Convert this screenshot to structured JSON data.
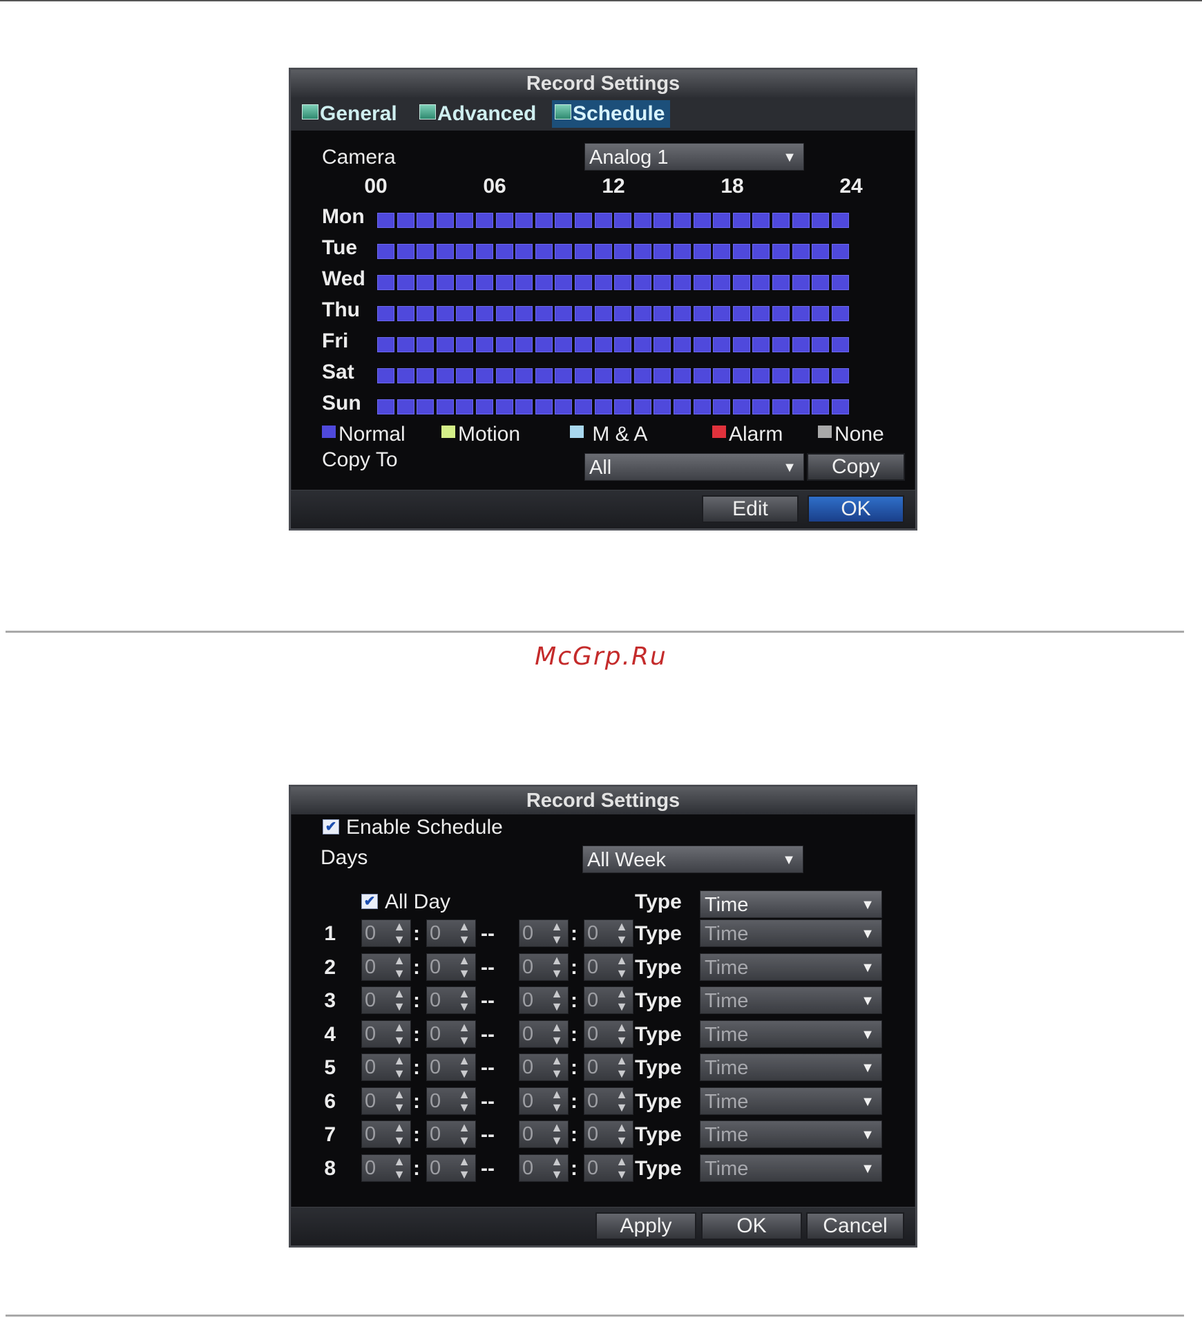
{
  "dialog1": {
    "title": "Record Settings",
    "tabs": [
      {
        "label": "General"
      },
      {
        "label": "Advanced"
      },
      {
        "label": "Schedule"
      }
    ],
    "camera_label": "Camera",
    "camera_value": "Analog 1",
    "hours": [
      "00",
      "06",
      "12",
      "18",
      "24"
    ],
    "days": [
      "Mon",
      "Tue",
      "Wed",
      "Thu",
      "Fri",
      "Sat",
      "Sun"
    ],
    "legend": [
      {
        "label": "Normal",
        "color": "#4f49dc"
      },
      {
        "label": "Motion",
        "color": "#d4ef88"
      },
      {
        "label": "M & A",
        "color": "#a9d8ef"
      },
      {
        "label": "Alarm",
        "color": "#e0323c"
      },
      {
        "label": "None",
        "color": "#a9a9a9"
      }
    ],
    "copy_to_label": "Copy To",
    "copy_to_value": "All",
    "copy_button": "Copy",
    "edit_button": "Edit",
    "ok_button": "OK"
  },
  "watermark": "McGrp.Ru",
  "dialog2": {
    "title": "Record Settings",
    "enable_schedule_label": "Enable Schedule",
    "enable_schedule_checked": true,
    "days_label": "Days",
    "days_value": "All Week",
    "all_day_label": "All Day",
    "all_day_checked": true,
    "type_label": "Type",
    "type_value": "Time",
    "periods": [
      {
        "num": "1",
        "start_h": "0",
        "start_m": "0",
        "end_h": "0",
        "end_m": "0",
        "type_label": "Type",
        "type_value": "Time"
      },
      {
        "num": "2",
        "start_h": "0",
        "start_m": "0",
        "end_h": "0",
        "end_m": "0",
        "type_label": "Type",
        "type_value": "Time"
      },
      {
        "num": "3",
        "start_h": "0",
        "start_m": "0",
        "end_h": "0",
        "end_m": "0",
        "type_label": "Type",
        "type_value": "Time"
      },
      {
        "num": "4",
        "start_h": "0",
        "start_m": "0",
        "end_h": "0",
        "end_m": "0",
        "type_label": "Type",
        "type_value": "Time"
      },
      {
        "num": "5",
        "start_h": "0",
        "start_m": "0",
        "end_h": "0",
        "end_m": "0",
        "type_label": "Type",
        "type_value": "Time"
      },
      {
        "num": "6",
        "start_h": "0",
        "start_m": "0",
        "end_h": "0",
        "end_m": "0",
        "type_label": "Type",
        "type_value": "Time"
      },
      {
        "num": "7",
        "start_h": "0",
        "start_m": "0",
        "end_h": "0",
        "end_m": "0",
        "type_label": "Type",
        "type_value": "Time"
      },
      {
        "num": "8",
        "start_h": "0",
        "start_m": "0",
        "end_h": "0",
        "end_m": "0",
        "type_label": "Type",
        "type_value": "Time"
      }
    ],
    "apply_button": "Apply",
    "ok_button": "OK",
    "cancel_button": "Cancel"
  }
}
